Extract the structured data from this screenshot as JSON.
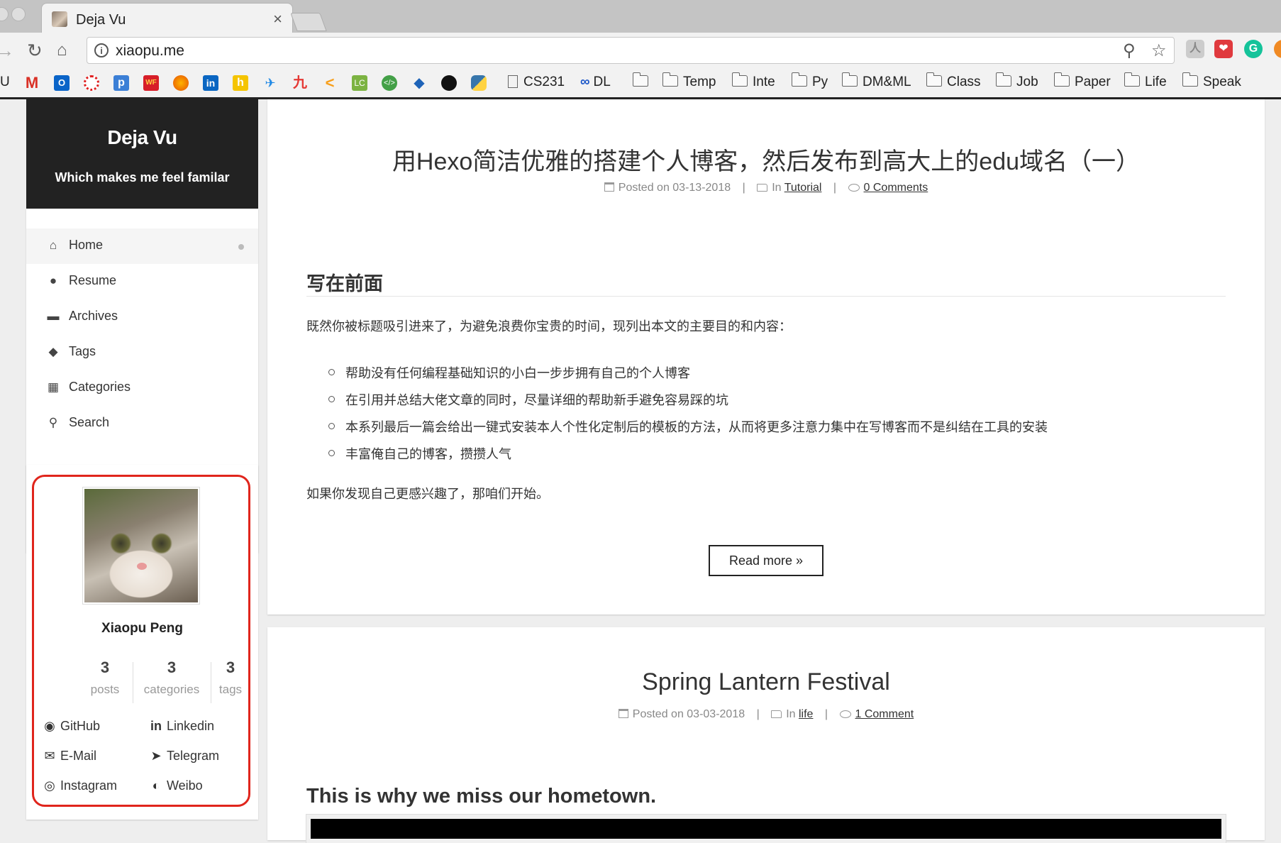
{
  "browser": {
    "tab_title": "Deja Vu",
    "tab_close": "×",
    "url": "xiaopu.me",
    "bookmark_edge_label": "U",
    "bookmarks": [
      {
        "label": "CS231",
        "type": "page"
      },
      {
        "label": "DL",
        "type": "infinity"
      },
      {
        "label": "",
        "type": "folder"
      },
      {
        "label": "Temp",
        "type": "folder"
      },
      {
        "label": "Inte",
        "type": "folder"
      },
      {
        "label": "Py",
        "type": "folder"
      },
      {
        "label": "DM&ML",
        "type": "folder"
      },
      {
        "label": "Class",
        "type": "folder"
      },
      {
        "label": "Job",
        "type": "folder"
      },
      {
        "label": "Paper",
        "type": "folder"
      },
      {
        "label": "Life",
        "type": "folder"
      },
      {
        "label": "Speak",
        "type": "folder"
      }
    ]
  },
  "sidebar": {
    "site_title": "Deja Vu",
    "site_subtitle": "Which makes me feel familar",
    "menu": [
      {
        "label": "Home",
        "icon": "home-icon",
        "active": true
      },
      {
        "label": "Resume",
        "icon": "user-icon"
      },
      {
        "label": "Archives",
        "icon": "archive-icon"
      },
      {
        "label": "Tags",
        "icon": "tags-icon"
      },
      {
        "label": "Categories",
        "icon": "grid-icon"
      },
      {
        "label": "Search",
        "icon": "search-icon"
      }
    ]
  },
  "profile": {
    "name": "Xiaopu Peng",
    "stats": [
      {
        "count": "3",
        "label": "posts"
      },
      {
        "count": "3",
        "label": "categories"
      },
      {
        "count": "3",
        "label": "tags"
      }
    ],
    "links": [
      {
        "label": "GitHub",
        "icon": "github-icon"
      },
      {
        "label": "Linkedin",
        "icon": "linkedin-icon"
      },
      {
        "label": "E-Mail",
        "icon": "mail-icon"
      },
      {
        "label": "Telegram",
        "icon": "telegram-icon"
      },
      {
        "label": "Instagram",
        "icon": "instagram-icon"
      },
      {
        "label": "Weibo",
        "icon": "weibo-icon"
      }
    ],
    "highlight_color": "#e0251c"
  },
  "posts": [
    {
      "title": "用Hexo简洁优雅的搭建个人博客，然后发布到高大上的edu域名（一）",
      "posted_on": "Posted on 03-13-2018",
      "in_prefix": "In",
      "category": "Tutorial",
      "comments": "0 Comments",
      "heading": "写在前面",
      "intro": "既然你被标题吸引进来了，为避免浪费你宝贵的时间，现列出本文的主要目的和内容：",
      "bullets": [
        "帮助没有任何编程基础知识的小白一步步拥有自己的个人博客",
        "在引用并总结大佬文章的同时，尽量详细的帮助新手避免容易踩的坑",
        "本系列最后一篇会给出一键式安装本人个性化定制后的模板的方法，从而将更多注意力集中在写博客而不是纠结在工具的安装",
        "丰富俺自己的博客，攒攒人气"
      ],
      "outro": "如果你发现自己更感兴趣了，那咱们开始。",
      "read_more": "Read more »"
    },
    {
      "title": "Spring Lantern Festival",
      "posted_on": "Posted on 03-03-2018",
      "in_prefix": "In",
      "category": "life",
      "comments": "1 Comment",
      "heading": "This is why we miss our hometown."
    }
  ]
}
